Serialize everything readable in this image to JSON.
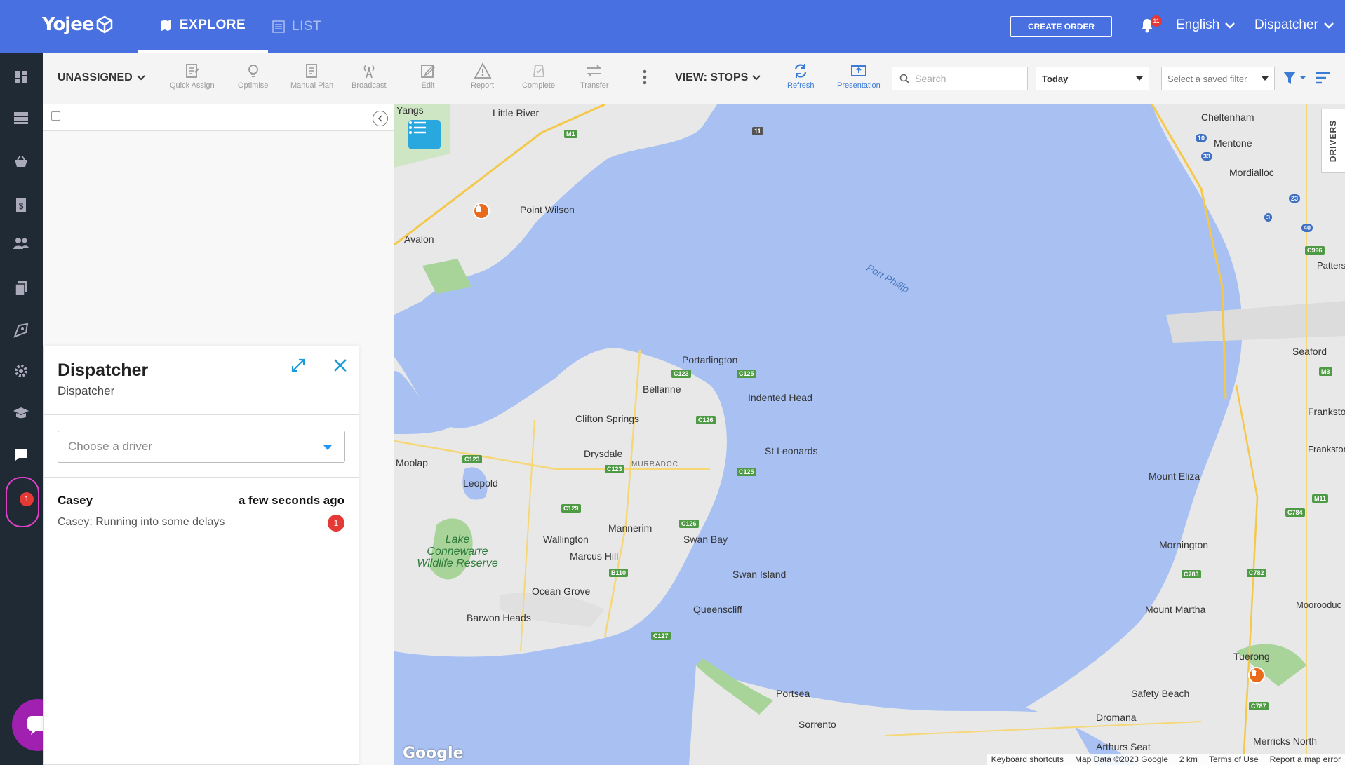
{
  "header": {
    "logo_text": "Yojee",
    "tabs": [
      {
        "label": "EXPLORE"
      },
      {
        "label": "LIST"
      }
    ],
    "create_order_label": "CREATE ORDER",
    "notification_count": "11",
    "language": "English",
    "user_role": "Dispatcher",
    "brand_color": "#4870e0"
  },
  "sidebar": {
    "items": [
      {
        "icon": "dashboard-icon"
      },
      {
        "icon": "orders-icon"
      },
      {
        "icon": "basket-icon"
      },
      {
        "icon": "invoice-icon"
      },
      {
        "icon": "users-icon"
      },
      {
        "icon": "documents-icon"
      },
      {
        "icon": "map-tag-icon"
      },
      {
        "icon": "settings-icon"
      },
      {
        "icon": "learning-icon"
      },
      {
        "icon": "chat-icon"
      }
    ],
    "chat_badge": "1"
  },
  "toolbar": {
    "unassigned_label": "UNASSIGNED",
    "tools": [
      {
        "label": "Quick Assign"
      },
      {
        "label": "Optimise"
      },
      {
        "label": "Manual Plan"
      },
      {
        "label": "Broadcast"
      },
      {
        "label": "Edit"
      },
      {
        "label": "Report"
      },
      {
        "label": "Complete"
      },
      {
        "label": "Transfer"
      }
    ],
    "view_label": "VIEW: STOPS",
    "refresh_label": "Refresh",
    "presentation_label": "Presentation",
    "search_placeholder": "Search",
    "date_value": "Today",
    "saved_filter_placeholder": "Select a saved filter"
  },
  "chat": {
    "title": "Dispatcher",
    "subtitle": "Dispatcher",
    "driver_placeholder": "Choose a driver",
    "messages": [
      {
        "name": "Casey",
        "time": "a few seconds ago",
        "text": "Casey: Running into some delays",
        "unread": "1"
      }
    ]
  },
  "map": {
    "drivers_tab_label": "DRIVERS",
    "water_color": "#a8c1f2",
    "land_color": "#e8e8e8",
    "places": [
      {
        "name": "Little River"
      },
      {
        "name": "Point Wilson"
      },
      {
        "name": "Avalon"
      },
      {
        "name": "Port Phillip"
      },
      {
        "name": "Portarlington"
      },
      {
        "name": "Bellarine"
      },
      {
        "name": "Indented Head"
      },
      {
        "name": "Clifton Springs"
      },
      {
        "name": "St Leonards"
      },
      {
        "name": "Drysdale"
      },
      {
        "name": "MURRADOC"
      },
      {
        "name": "Moolap"
      },
      {
        "name": "Leopold"
      },
      {
        "name": "Mannerim"
      },
      {
        "name": "Wallington"
      },
      {
        "name": "Swan Bay"
      },
      {
        "name": "Marcus Hill"
      },
      {
        "name": "Swan Island"
      },
      {
        "name": "Lake Connewarre Wildlife Reserve"
      },
      {
        "name": "Ocean Grove"
      },
      {
        "name": "Queenscliff"
      },
      {
        "name": "Barwon Heads"
      },
      {
        "name": "Portsea"
      },
      {
        "name": "Sorrento"
      },
      {
        "name": "Cheltenham"
      },
      {
        "name": "Mentone"
      },
      {
        "name": "Mordialloc"
      },
      {
        "name": "Seaford"
      },
      {
        "name": "Frankston"
      },
      {
        "name": "Mount Eliza"
      },
      {
        "name": "Mornington"
      },
      {
        "name": "Mount Martha"
      },
      {
        "name": "Tuerong"
      },
      {
        "name": "Safety Beach"
      },
      {
        "name": "Dromana"
      },
      {
        "name": "Arthurs Seat"
      },
      {
        "name": "Merricks North"
      },
      {
        "name": "Yangs"
      },
      {
        "name": "Patterson Lakes"
      },
      {
        "name": "Frankston South"
      },
      {
        "name": "Moorooduc"
      }
    ],
    "roads": [
      "M1",
      "11",
      "C123",
      "C125",
      "C126",
      "C129",
      "B110",
      "C127",
      "10",
      "33",
      "23",
      "3",
      "40",
      "C996",
      "M3",
      "M11",
      "C784",
      "C783",
      "C782",
      "C787"
    ],
    "footer": {
      "keyboard_shortcuts": "Keyboard shortcuts",
      "map_data": "Map Data ©2023 Google",
      "scale": "2 km",
      "terms": "Terms of Use",
      "report": "Report a map error"
    },
    "google_logo": "Google"
  }
}
